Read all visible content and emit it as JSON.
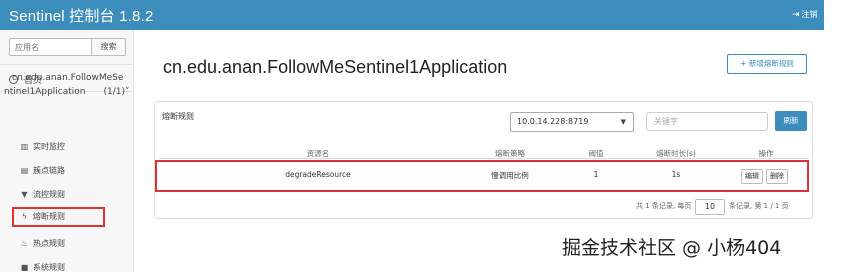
{
  "header": {
    "title": "Sentinel 控制台 1.8.2",
    "logout_label": "注销",
    "logout_icon": "sign-out-icon",
    "bar_color": "#3c8dbc"
  },
  "sidebar": {
    "search_placeholder": "应用名",
    "search_button": "搜索",
    "home_label": "首页",
    "home_icon": "dashboard-icon",
    "app_name_line1": "cn.edu.anan.FollowMeSe",
    "app_name_line2": "ntinel1Application",
    "app_count": "(1/1)",
    "app_chevron": "˅",
    "menu": [
      {
        "label": "实时监控",
        "icon": "bar-chart-icon",
        "glyph": "📊"
      },
      {
        "label": "簇点链路",
        "icon": "list-icon",
        "glyph": "▤"
      },
      {
        "label": "流控规则",
        "icon": "filter-icon",
        "glyph": "▼"
      },
      {
        "label": "熔断规则",
        "icon": "flash-icon",
        "glyph": "ϟ"
      },
      {
        "label": "热点规则",
        "icon": "fire-icon",
        "glyph": "♨"
      },
      {
        "label": "系统规则",
        "icon": "lock-icon",
        "glyph": "🔒"
      }
    ],
    "active_color": "#dd3333"
  },
  "main": {
    "app_title": "cn.edu.anan.FollowMeSentinel1Application",
    "add_button": "+ 新增熔断规则",
    "panel_title": "熔断规则",
    "machine_select": "10.0.14.228:8719",
    "select_caret": "▼",
    "keyword_placeholder": "关键字",
    "refresh_button": "刷新",
    "table": {
      "headers": [
        "资源名",
        "熔断策略",
        "阈值",
        "熔断时长(s)",
        "操作"
      ],
      "rows": [
        {
          "resource": "degradeResource",
          "strategy": "慢调用比例",
          "threshold": "1",
          "duration": "1s",
          "edit": "编辑",
          "delete": "删除"
        }
      ]
    },
    "pager": {
      "summary": "共 1 条记录, 每页",
      "page_size": "10",
      "suffix": "条记录, 第 1 / 1 页"
    }
  },
  "watermark": "掘金技术社区 @ 小杨404"
}
